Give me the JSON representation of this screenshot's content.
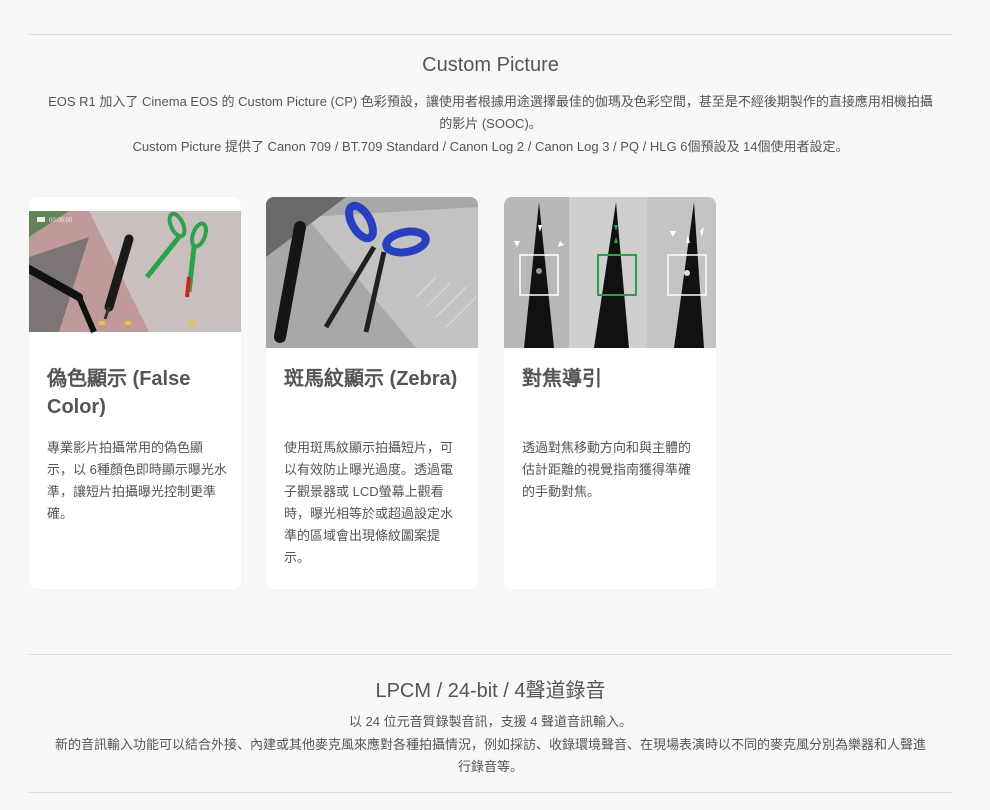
{
  "custom_picture": {
    "title": "Custom Picture",
    "line1": "EOS R1 加入了 Cinema EOS 的 Custom Picture (CP) 色彩預設，讓使用者根據用途選擇最佳的伽瑪及色彩空間，甚至是不經後期製作的直接應用相機拍攝",
    "line2": "的影片 (SOOC)。",
    "line3": "Custom Picture 提供了 Canon 709 / BT.709 Standard / Canon Log 2 / Canon Log 3 / PQ / HLG 6個預設及 14個使用者設定。"
  },
  "cards": [
    {
      "title": "偽色顯示 (False Color)",
      "text": "專業影片拍攝常用的偽色顯示，以 6種顏色即時顯示曝光水準，讓短片拍攝曝光控制更準確。",
      "overlay_text": "00:00:00"
    },
    {
      "title": "斑馬紋顯示 (Zebra)",
      "text": "使用斑馬紋顯示拍攝短片，可以有效防止曝光過度。透過電子觀景器或 LCD螢幕上觀看時，曝光相等於或超過設定水準的區域會出現條紋圖案提示。"
    },
    {
      "title": "對焦導引",
      "text": "透過對焦移動方向和與主體的估計距離的視覺指南獲得準確的手動對焦。"
    }
  ],
  "lpcm": {
    "title": "LPCM / 24-bit / 4聲道錄音",
    "line1": "以 24 位元音質錄製音訊，支援 4 聲道音訊輸入。",
    "line2": "新的音訊輸入功能可以結合外接、內建或其他麥克風來應對各種拍攝情況，例如採訪、收錄環境聲音、在現場表演時以不同的麥克風分別為樂器和人聲進",
    "line3": "行錄音等。"
  },
  "colors": {
    "background": "#f8f8f8",
    "card": "#ffffff",
    "text": "#555555",
    "rule": "#dcdcdc",
    "focus_green": "#2aa14a",
    "scissor_blue": "#2a3fc0"
  }
}
